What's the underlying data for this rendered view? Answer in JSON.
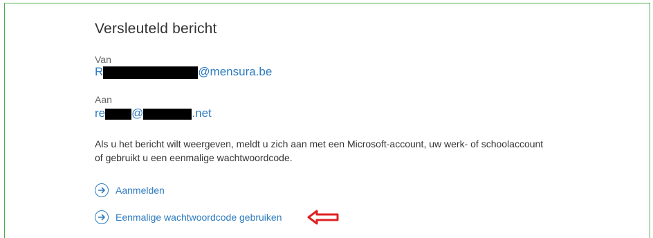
{
  "title": "Versleuteld bericht",
  "from": {
    "label": "Van",
    "prefix": "R",
    "suffix": "@mensura.be"
  },
  "to": {
    "label": "Aan",
    "prefix": "re",
    "mid": "@",
    "suffix": ".net"
  },
  "message": {
    "line1": "Als u het bericht wilt weergeven, meldt u zich aan met een Microsoft-account, uw werk- of schoolaccount",
    "line2": "of gebruikt u een eenmalige wachtwoordcode."
  },
  "actions": {
    "signin_label": "Aanmelden",
    "otp_label": "Eenmalige wachtwoordcode gebruiken"
  },
  "colors": {
    "link": "#2e7bbf",
    "frame": "#4cae4c",
    "annotation_arrow": "#e02020"
  },
  "icons": {
    "action": "arrow-circle-right-icon",
    "annotation": "red-outline-arrow-left-icon"
  }
}
